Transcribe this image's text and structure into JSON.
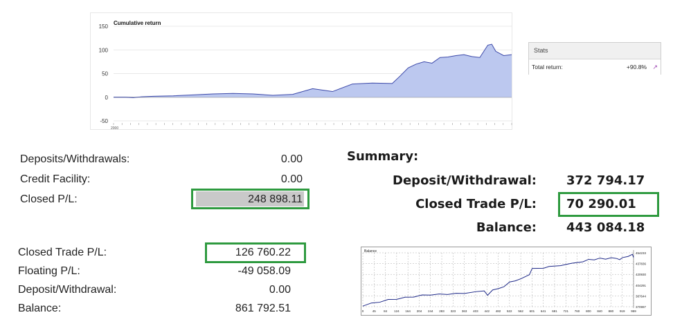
{
  "cumulative_chart": {
    "title": "Cumulative return",
    "fill_color": "#bcc8ef",
    "line_color": "#3a47a8",
    "x_tick_label": "2000"
  },
  "stats": {
    "header": "Stats",
    "total_return_label": "Total return:",
    "total_return_value": "+90.8%",
    "chart_icon": "chart-link-icon"
  },
  "panel1": {
    "deposits_label": "Deposits/Withdrawals:",
    "deposits_value": "0.00",
    "credit_label": "Credit Facility:",
    "credit_value": "0.00",
    "closed_label": "Closed P/L:",
    "closed_value": "248 898.11"
  },
  "summary": {
    "title": "Summary:",
    "deposit_label": "Deposit/Withdrawal:",
    "deposit_value": "372 794.17",
    "closed_label": "Closed Trade P/L:",
    "closed_value": "70 290.01",
    "balance_label": "Balance:",
    "balance_value": "443 084.18"
  },
  "panel3": {
    "closed_label": "Closed Trade P/L:",
    "closed_value": "126 760.22",
    "floating_label": "Floating P/L:",
    "floating_value": "-49 058.09",
    "deposit_label": "Deposit/Withdrawal:",
    "deposit_value": "0.00",
    "balance_label": "Balance:",
    "balance_value": "861 792.51"
  },
  "balance_chart": {
    "title": "Balance",
    "line_color": "#1c2787"
  },
  "chart_data": [
    {
      "type": "area",
      "title": "Cumulative return",
      "ylim": [
        -50,
        150
      ],
      "y_ticks": [
        150,
        100,
        50,
        0,
        -50
      ],
      "grid": true,
      "x": [
        0,
        0.03,
        0.05,
        0.07,
        0.1,
        0.15,
        0.2,
        0.25,
        0.3,
        0.35,
        0.4,
        0.45,
        0.5,
        0.55,
        0.6,
        0.65,
        0.7,
        0.72,
        0.74,
        0.76,
        0.78,
        0.8,
        0.82,
        0.84,
        0.86,
        0.88,
        0.9,
        0.92,
        0.94,
        0.95,
        0.96,
        0.98,
        1.0
      ],
      "values": [
        0,
        0,
        -1,
        1,
        2,
        3,
        5,
        7,
        8,
        7,
        4,
        6,
        18,
        12,
        28,
        30,
        29,
        45,
        62,
        70,
        75,
        72,
        84,
        85,
        88,
        90,
        86,
        84,
        110,
        112,
        97,
        88,
        90
      ]
    },
    {
      "type": "line",
      "title": "Balance",
      "x_ticks": [
        "0",
        "45",
        "84",
        "124",
        "164",
        "204",
        "244",
        "283",
        "323",
        "363",
        "403",
        "442",
        "482",
        "522",
        "562",
        "601",
        "641",
        "681",
        "721",
        "760",
        "800",
        "840",
        "880",
        "919",
        "959"
      ],
      "y_ticks": [
        "454233",
        "437836",
        "420930",
        "404291",
        "387644",
        "370997"
      ],
      "ylim": [
        370997,
        454233
      ],
      "x": [
        0,
        30,
        60,
        90,
        120,
        150,
        180,
        210,
        240,
        270,
        300,
        330,
        360,
        400,
        430,
        442,
        460,
        482,
        500,
        520,
        540,
        560,
        590,
        600,
        640,
        660,
        700,
        740,
        780,
        800,
        820,
        840,
        860,
        880,
        900,
        910,
        920,
        940,
        955,
        959
      ],
      "values": [
        372500,
        376000,
        378500,
        381500,
        383000,
        385000,
        386500,
        388500,
        389500,
        390000,
        390500,
        391000,
        392000,
        393500,
        396000,
        388000,
        397500,
        398500,
        402500,
        408500,
        411500,
        413500,
        421000,
        429500,
        431000,
        432500,
        435000,
        437500,
        441000,
        443500,
        444000,
        445500,
        445000,
        446000,
        446000,
        443000,
        447500,
        448000,
        452500,
        446500
      ]
    }
  ]
}
